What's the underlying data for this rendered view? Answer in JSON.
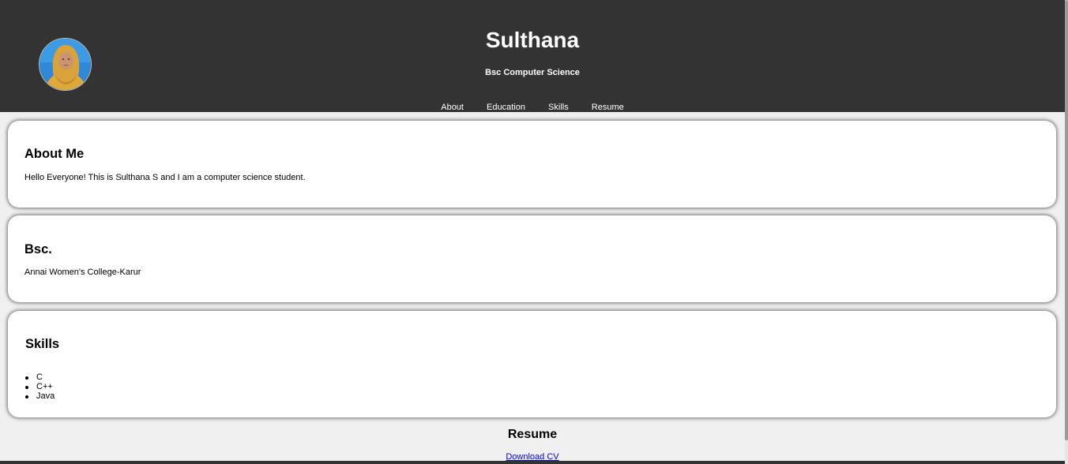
{
  "header": {
    "name": "Sulthana",
    "subtitle": "Bsc Computer Science",
    "nav": [
      {
        "label": "About"
      },
      {
        "label": "Education"
      },
      {
        "label": "Skills"
      },
      {
        "label": "Resume"
      }
    ]
  },
  "about": {
    "heading": "About Me",
    "text": "Hello Everyone! This is Sulthana S and I am a computer science student."
  },
  "education": {
    "heading": "Bsc.",
    "text": "Annai Women's College-Karur"
  },
  "skills": {
    "heading": "Skills",
    "items": [
      "C",
      "C++",
      "Java"
    ]
  },
  "resume": {
    "heading": "Resume",
    "download_label": "Download CV"
  },
  "colors": {
    "header_bg": "#333333",
    "page_bg": "#f0f0f0",
    "card_bg": "#ffffff",
    "link": "#0000ee"
  }
}
